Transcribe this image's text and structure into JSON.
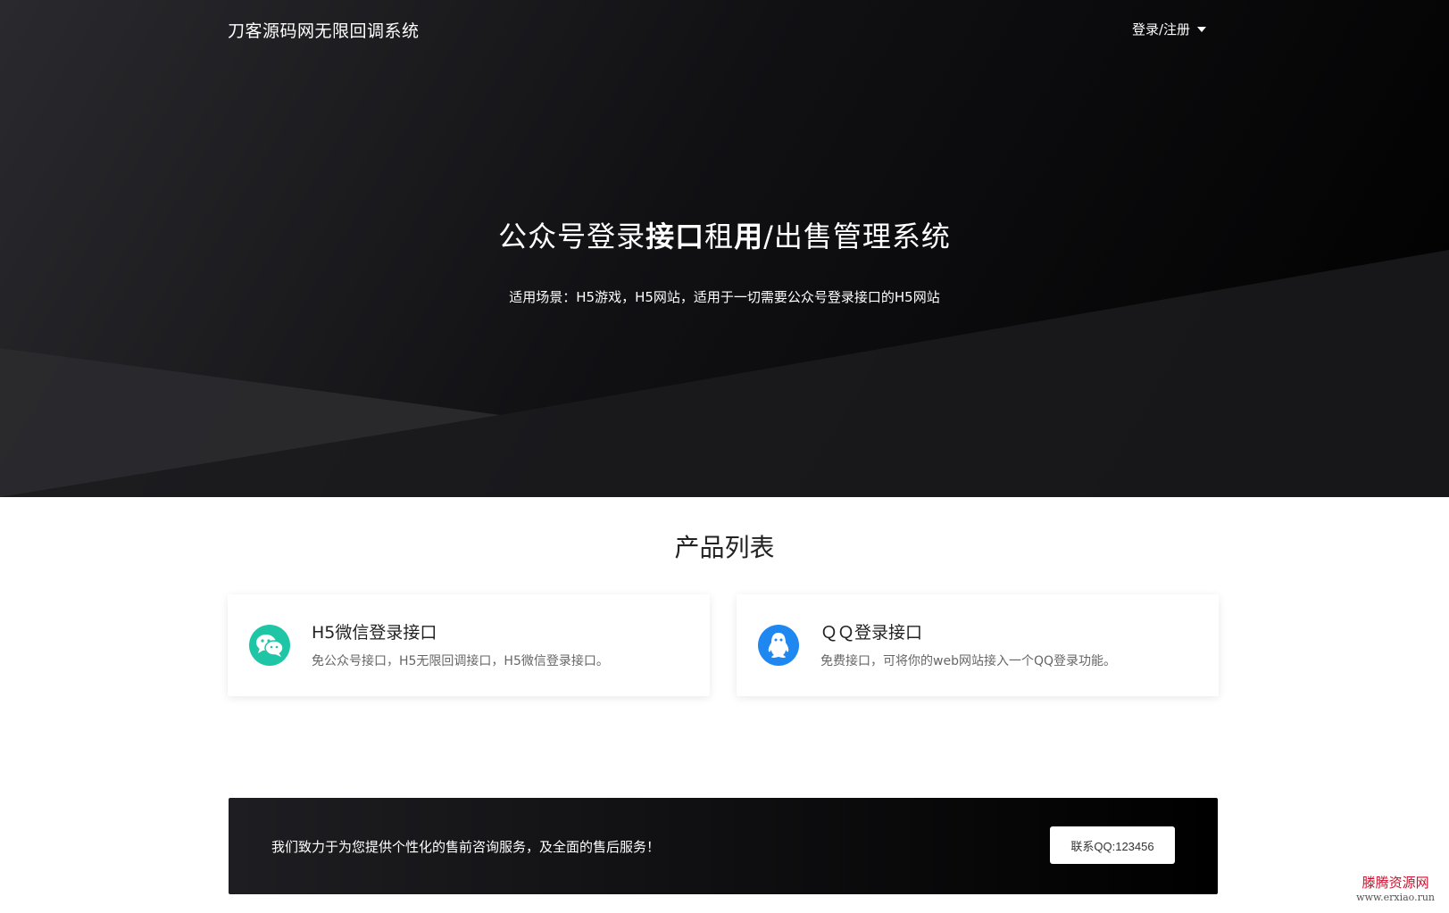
{
  "nav": {
    "brand": "刀客源码网无限回调系统",
    "login_label": "登录/注册"
  },
  "hero": {
    "title_part1": "公众号登录",
    "title_bold1": "接口",
    "title_part2": "租",
    "title_bold2": "用",
    "title_part3": "/出售管理系统",
    "subtitle": "适用场景：H5游戏，H5网站，适用于一切需要公众号登录接口的H5网站"
  },
  "products": {
    "heading": "产品列表",
    "items": [
      {
        "title": "H5微信登录接口",
        "desc": "免公众号接口，H5无限回调接口，H5微信登录接口。",
        "icon": "wechat-icon",
        "color": "#1fc6a6"
      },
      {
        "title": "ＱＱ登录接口",
        "desc": "免费接口，可将你的web网站接入一个QQ登录功能。",
        "icon": "qq-icon",
        "color": "#1e88f0"
      }
    ]
  },
  "cta": {
    "text": "我们致力于为您提供个性化的售前咨询服务，及全面的售后服务！",
    "button_label": "联系QQ:123456"
  },
  "watermark": {
    "line1": "滕腾资源网",
    "line2": "www.erxiao.run"
  }
}
